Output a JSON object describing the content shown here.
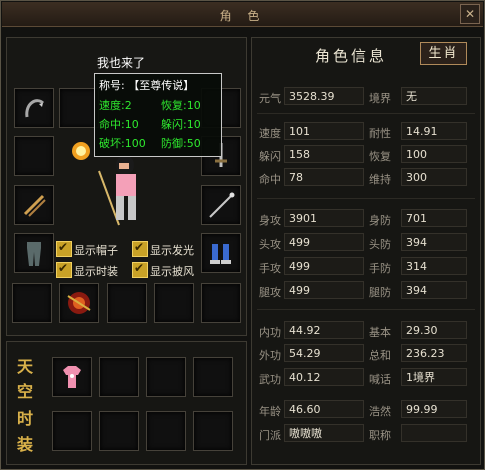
{
  "window": {
    "title": "角 色",
    "close": "✕"
  },
  "character": {
    "name": "我也来了",
    "tooltip": {
      "title_label": "称号:",
      "title_value": "【至尊传说】",
      "rows": [
        {
          "l_label": "速度:",
          "l_value": "2",
          "r_label": "恢复:",
          "r_value": "10"
        },
        {
          "l_label": "命中:",
          "l_value": "10",
          "r_label": "躲闪:",
          "r_value": "10"
        },
        {
          "l_label": "破坏:",
          "l_value": "100",
          "r_label": "防御:",
          "r_value": "50"
        }
      ]
    },
    "toggles": [
      {
        "label": "显示帽子",
        "checked": true
      },
      {
        "label": "显示发光",
        "checked": true
      },
      {
        "label": "显示时装",
        "checked": true
      },
      {
        "label": "显示披风",
        "checked": true
      }
    ]
  },
  "fashion": {
    "label_chars": [
      "天",
      "空",
      "时",
      "装"
    ]
  },
  "stats_panel": {
    "title": "角色信息",
    "zodiac_button": "生肖",
    "groups": [
      [
        {
          "label": "元气",
          "value": "3528.39"
        },
        {
          "label": "境界",
          "value": "无"
        }
      ],
      [
        {
          "label": "速度",
          "value": "101"
        },
        {
          "label": "耐性",
          "value": "14.91"
        },
        {
          "label": "躲闪",
          "value": "158"
        },
        {
          "label": "恢复",
          "value": "100"
        },
        {
          "label": "命中",
          "value": "78"
        },
        {
          "label": "维持",
          "value": "300"
        }
      ],
      [
        {
          "label": "身攻",
          "value": "3901"
        },
        {
          "label": "身防",
          "value": "701"
        },
        {
          "label": "头攻",
          "value": "499"
        },
        {
          "label": "头防",
          "value": "394"
        },
        {
          "label": "手攻",
          "value": "499"
        },
        {
          "label": "手防",
          "value": "314"
        },
        {
          "label": "腿攻",
          "value": "499"
        },
        {
          "label": "腿防",
          "value": "394"
        }
      ],
      [
        {
          "label": "内功",
          "value": "44.92"
        },
        {
          "label": "基本",
          "value": "29.30"
        },
        {
          "label": "外功",
          "value": "54.29"
        },
        {
          "label": "总和",
          "value": "236.23"
        },
        {
          "label": "武功",
          "value": "40.12"
        },
        {
          "label": "喊话",
          "value": "1境界"
        },
        {
          "label": "年龄",
          "value": "46.60"
        },
        {
          "label": "浩然",
          "value": "99.99"
        },
        {
          "label": "门派",
          "value": "嗷嗷嗷"
        },
        {
          "label": "职称",
          "value": ""
        }
      ]
    ]
  },
  "colors": {
    "gold": "#d9b14a",
    "tooltip_green": "#2ee82e",
    "frame": "#5a5446"
  },
  "icons": [
    "close-icon",
    "hook-icon",
    "sword-icon",
    "double-blade-icon",
    "staff-icon",
    "pants-icon",
    "boots-icon",
    "fire-orb-icon",
    "red-ornament-icon",
    "pink-shirt-icon",
    "checkmark-icon"
  ]
}
